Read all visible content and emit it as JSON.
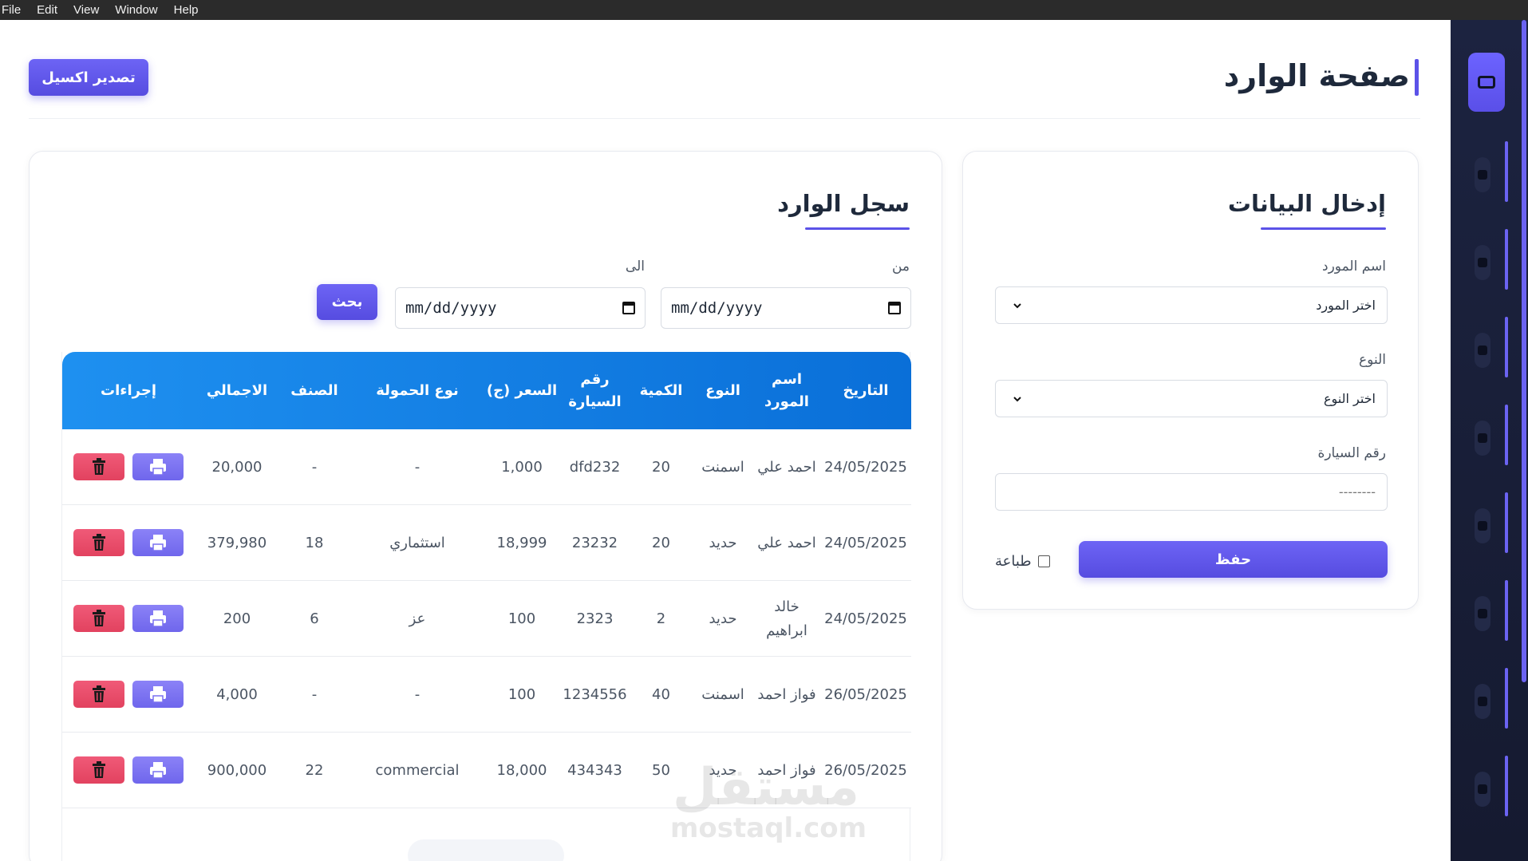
{
  "menubar": {
    "file": "File",
    "edit": "Edit",
    "view": "View",
    "window": "Window",
    "help": "Help"
  },
  "header": {
    "title": "صفحة الوارد",
    "export_label": "تصدير اكسيل"
  },
  "form": {
    "heading": "إدخال البيانات",
    "supplier_label": "اسم المورد",
    "supplier_value": "اختر المورد",
    "type_label": "النوع",
    "type_value": "اختر النوع",
    "car_label": "رقم السيارة",
    "car_placeholder": "--------",
    "save_label": "حفظ",
    "print_label": "طباعة"
  },
  "log": {
    "heading": "سجل الوارد",
    "from_label": "من",
    "to_label": "الى",
    "date_placeholder": "mm/dd/yyyy",
    "search_label": "بحث",
    "columns": {
      "date": "التاريخ",
      "supplier": "اسم المورد",
      "type": "النوع",
      "qty": "الكمية",
      "car": "رقم السيارة",
      "price": "السعر (ج)",
      "load": "نوع الحمولة",
      "category": "الصنف",
      "total": "الاجمالي",
      "actions": "إجراءات"
    },
    "rows": [
      {
        "date": "24/05/2025",
        "supplier": "احمد علي",
        "type": "اسمنت",
        "qty": "20",
        "car": "dfd232",
        "price": "1,000",
        "load": "-",
        "category": "-",
        "total": "20,000"
      },
      {
        "date": "24/05/2025",
        "supplier": "احمد علي",
        "type": "حديد",
        "qty": "20",
        "car": "23232",
        "price": "18,999",
        "load": "استثماري",
        "category": "18",
        "total": "379,980"
      },
      {
        "date": "24/05/2025",
        "supplier": "خالد ابراهيم",
        "type": "حديد",
        "qty": "2",
        "car": "2323",
        "price": "100",
        "load": "عز",
        "category": "6",
        "total": "200"
      },
      {
        "date": "26/05/2025",
        "supplier": "فواز احمد",
        "type": "اسمنت",
        "qty": "40",
        "car": "1234556",
        "price": "100",
        "load": "-",
        "category": "-",
        "total": "4,000"
      },
      {
        "date": "26/05/2025",
        "supplier": "فواز احمد",
        "type": "حديد",
        "qty": "50",
        "car": "434343",
        "price": "18,000",
        "load": "commercial",
        "category": "22",
        "total": "900,000"
      }
    ]
  },
  "watermark": {
    "arabic": "مستقل",
    "latin": "mostaql.com"
  },
  "icons": {
    "sidebar": [
      "inbox-icon",
      "send-icon",
      "truck-icon",
      "users-icon",
      "money-icon",
      "car-icon",
      "user-icon",
      "clock-icon",
      "report-icon"
    ],
    "row_actions": [
      "print-icon",
      "trash-icon"
    ]
  },
  "colors": {
    "accent": "#5b52e8",
    "table_header": "#1e90f0",
    "delete": "#e8486a",
    "sidebar_bg": "#1c2340"
  }
}
